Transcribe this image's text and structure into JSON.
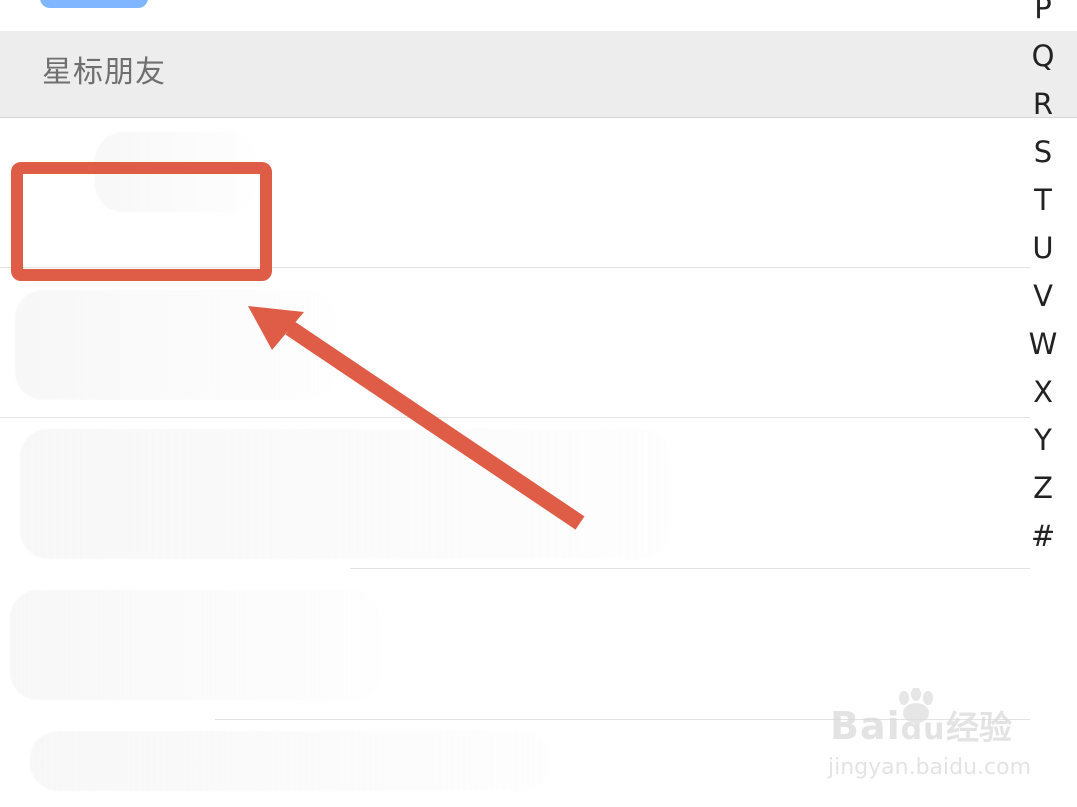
{
  "section": {
    "title": "星标朋友"
  },
  "alphabet_index": [
    "P",
    "Q",
    "R",
    "S",
    "T",
    "U",
    "V",
    "W",
    "X",
    "Y",
    "Z",
    "#"
  ],
  "watermark": {
    "brand": "Bai",
    "brand_tail": "du",
    "chinese": "经验",
    "url": "jingyan.baidu.com"
  },
  "colors": {
    "annotation_red": "#df5d47",
    "section_bg": "#ededed",
    "accent_blue": "#7fb6ff"
  },
  "icons": {
    "annotation": "red-box-icon",
    "arrow": "arrow-icon",
    "paw": "paw-icon"
  }
}
